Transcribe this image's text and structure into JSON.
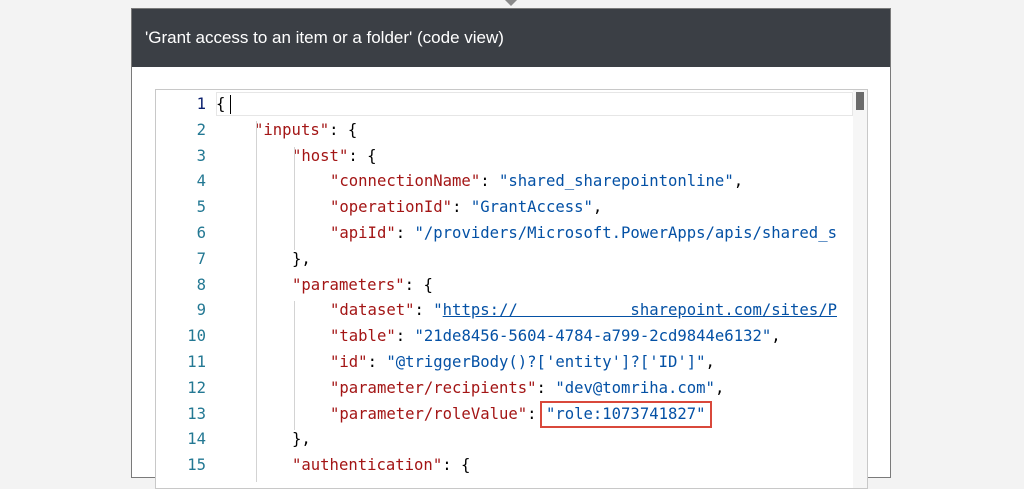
{
  "panel": {
    "title": "'Grant access to an item or a folder' (code view)"
  },
  "editor": {
    "line_numbers": [
      "1",
      "2",
      "3",
      "4",
      "5",
      "6",
      "7",
      "8",
      "9",
      "10",
      "11",
      "12",
      "13",
      "14",
      "15"
    ],
    "lines": [
      [
        {
          "t": "{",
          "c": "punc"
        }
      ],
      [
        {
          "t": "\"inputs\"",
          "c": "key"
        },
        {
          "t": ": {",
          "c": "punc"
        }
      ],
      [
        {
          "t": "\"host\"",
          "c": "key"
        },
        {
          "t": ": {",
          "c": "punc"
        }
      ],
      [
        {
          "t": "\"connectionName\"",
          "c": "key"
        },
        {
          "t": ": ",
          "c": "punc"
        },
        {
          "t": "\"shared_sharepointonline\"",
          "c": "str"
        },
        {
          "t": ",",
          "c": "punc"
        }
      ],
      [
        {
          "t": "\"operationId\"",
          "c": "key"
        },
        {
          "t": ": ",
          "c": "punc"
        },
        {
          "t": "\"GrantAccess\"",
          "c": "str"
        },
        {
          "t": ",",
          "c": "punc"
        }
      ],
      [
        {
          "t": "\"apiId\"",
          "c": "key"
        },
        {
          "t": ": ",
          "c": "punc"
        },
        {
          "t": "\"/providers/Microsoft.PowerApps/apis/shared_s",
          "c": "str"
        }
      ],
      [
        {
          "t": "},",
          "c": "punc"
        }
      ],
      [
        {
          "t": "\"parameters\"",
          "c": "key"
        },
        {
          "t": ": {",
          "c": "punc"
        }
      ],
      [
        {
          "t": "\"dataset\"",
          "c": "key"
        },
        {
          "t": ": ",
          "c": "punc"
        },
        {
          "t": "\"",
          "c": "str"
        },
        {
          "t": "https://            sharepoint.com/sites/P",
          "c": "link"
        }
      ],
      [
        {
          "t": "\"table\"",
          "c": "key"
        },
        {
          "t": ": ",
          "c": "punc"
        },
        {
          "t": "\"21de8456-5604-4784-a799-2cd9844e6132\"",
          "c": "str"
        },
        {
          "t": ",",
          "c": "punc"
        }
      ],
      [
        {
          "t": "\"id\"",
          "c": "key"
        },
        {
          "t": ": ",
          "c": "punc"
        },
        {
          "t": "\"@triggerBody()?['entity']?['ID']\"",
          "c": "str"
        },
        {
          "t": ",",
          "c": "punc"
        }
      ],
      [
        {
          "t": "\"parameter/recipients\"",
          "c": "key"
        },
        {
          "t": ": ",
          "c": "punc"
        },
        {
          "t": "\"dev@tomriha.com\"",
          "c": "str"
        },
        {
          "t": ",",
          "c": "punc"
        }
      ],
      [
        {
          "t": "\"parameter/roleValue\"",
          "c": "key"
        },
        {
          "t": ": ",
          "c": "punc"
        },
        {
          "t": "\"role:1073741827\"",
          "c": "str"
        }
      ],
      [
        {
          "t": "},",
          "c": "punc"
        }
      ],
      [
        {
          "t": "\"authentication\"",
          "c": "key"
        },
        {
          "t": ": {",
          "c": "punc"
        }
      ]
    ],
    "indent_levels": [
      0,
      1,
      2,
      3,
      3,
      3,
      2,
      2,
      3,
      3,
      3,
      3,
      3,
      2,
      2
    ],
    "active_line": 1,
    "highlighted_line": 13,
    "highlight_color": "#d9483b"
  }
}
